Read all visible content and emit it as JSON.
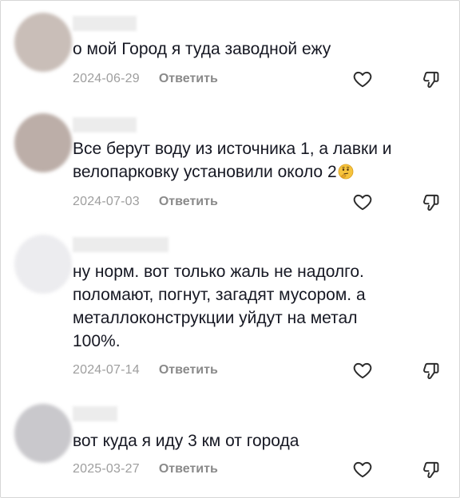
{
  "comments": [
    {
      "text": "о мой Город я туда заводной ежу",
      "date": "2024-06-29",
      "reply": "Ответить",
      "avatar_color": "#c9beb8"
    },
    {
      "text": "Все берут воду из источника 1, а лавки и\nвелопарковку установили около 2",
      "date": "2024-07-03",
      "reply": "Ответить",
      "emoji": "thinking-face",
      "avatar_color": "#bcaea8"
    },
    {
      "text": "ну норм. вот только жаль не надолго.\nполомают, погнут, загадят мусором. а\nметаллоконструкции уйдут на метал\n100%.",
      "date": "2024-07-14",
      "reply": "Ответить",
      "avatar_color": "#ececef"
    },
    {
      "text": "вот куда я иду 3 км от города",
      "date": "2025-03-27",
      "reply": "Ответить",
      "avatar_color": "#c9c8cc"
    }
  ],
  "icons": {
    "like": "heart-outline-icon",
    "dislike": "thumbs-down-outline-icon"
  }
}
